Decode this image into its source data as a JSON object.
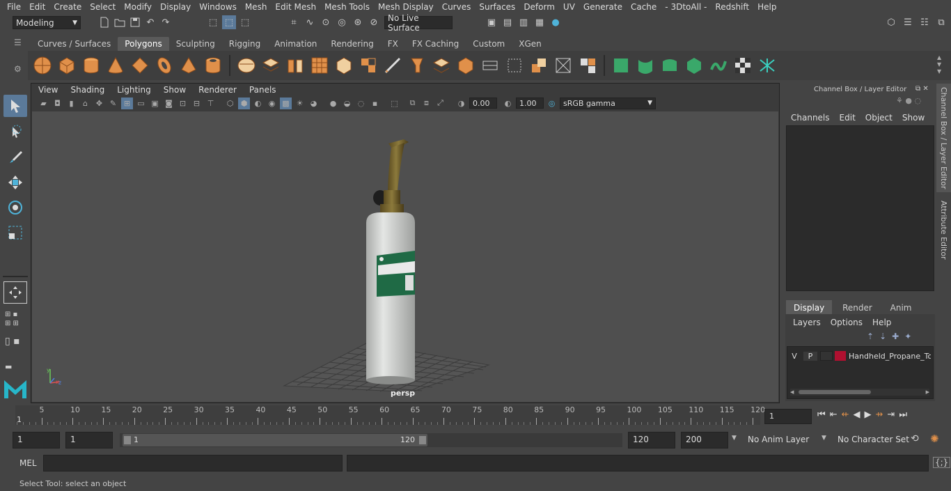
{
  "menus": [
    "File",
    "Edit",
    "Create",
    "Select",
    "Modify",
    "Display",
    "Windows",
    "Mesh",
    "Edit Mesh",
    "Mesh Tools",
    "Mesh Display",
    "Curves",
    "Surfaces",
    "Deform",
    "UV",
    "Generate",
    "Cache",
    "- 3DtoAll -",
    "Redshift",
    "Help"
  ],
  "status": {
    "mode": "Modeling",
    "live_surface": "No Live Surface"
  },
  "shelf_tabs": [
    "Curves / Surfaces",
    "Polygons",
    "Sculpting",
    "Rigging",
    "Animation",
    "Rendering",
    "FX",
    "FX Caching",
    "Custom",
    "XGen"
  ],
  "shelf_active": "Polygons",
  "panel_menus": [
    "View",
    "Shading",
    "Lighting",
    "Show",
    "Renderer",
    "Panels"
  ],
  "panel_toolbar": {
    "exposure": "0.00",
    "gamma": "1.00",
    "colorspace": "sRGB gamma"
  },
  "viewport": {
    "camera_label": "persp",
    "bottle_label_color": "#1f6a45",
    "bottle_color": "#d4d6d4"
  },
  "channel_box": {
    "title": "Channel Box / Layer Editor",
    "menus": [
      "Channels",
      "Edit",
      "Object",
      "Show"
    ]
  },
  "side_tabs": [
    "Channel Box / Layer Editor",
    "Attribute Editor"
  ],
  "layer_editor": {
    "tabs": [
      "Display",
      "Render",
      "Anim"
    ],
    "active_tab": "Display",
    "menus": [
      "Layers",
      "Options",
      "Help"
    ],
    "layer": {
      "visible": "V",
      "playback": "P",
      "color": "#b01030",
      "name": "Handheld_Propane_To"
    }
  },
  "timeline": {
    "ticks": [
      5,
      10,
      15,
      20,
      25,
      30,
      35,
      40,
      45,
      50,
      55,
      60,
      65,
      70,
      75,
      80,
      85,
      90,
      95,
      100,
      105,
      110,
      115,
      120
    ],
    "current_frame_marker": "1",
    "current_frame": "1"
  },
  "range": {
    "start_frame": "1",
    "playback_start": "1",
    "slider_start": "1",
    "slider_end": "120",
    "playback_end": "120",
    "end_frame": "200",
    "anim_layer": "No Anim Layer",
    "character_set": "No Character Set"
  },
  "command_line": {
    "label": "MEL"
  },
  "help_line": "Select Tool: select an object"
}
